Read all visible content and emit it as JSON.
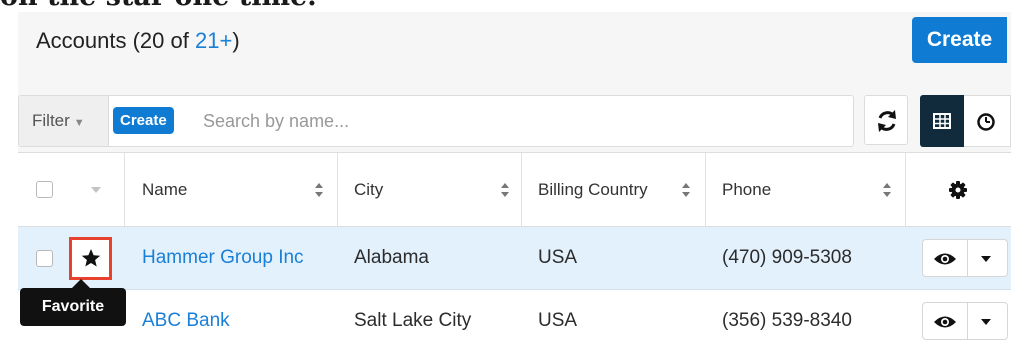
{
  "intro": {
    "text": "on the star one time."
  },
  "header": {
    "title": "Accounts (20 of ",
    "count": "21+",
    "title_end": ")",
    "create_label": "Create"
  },
  "filterbar": {
    "filter_label": "Filter",
    "create_label": "Create",
    "search_placeholder": "Search by name..."
  },
  "table": {
    "columns": [
      "Name",
      "City",
      "Billing Country",
      "Phone"
    ],
    "rows": [
      {
        "name": "Hammer Group Inc",
        "city": "Alabama",
        "country": "USA",
        "phone": "(470) 909-5308",
        "selected": true
      },
      {
        "name": "ABC Bank",
        "city": "Salt Lake City",
        "country": "USA",
        "phone": "(356) 539-8340",
        "selected": false
      }
    ]
  },
  "tooltip": {
    "text": "Favorite"
  },
  "colors": {
    "accent": "#0f7bd3",
    "highlight_border": "#e8412c",
    "selected_row": "#e3f1fc",
    "dark_button": "#112b3c"
  },
  "icons": [
    "star-icon",
    "sort-icon",
    "gear-icon",
    "refresh-icon",
    "grid-view-icon",
    "clock-icon",
    "eye-icon",
    "chevron-down-icon"
  ]
}
